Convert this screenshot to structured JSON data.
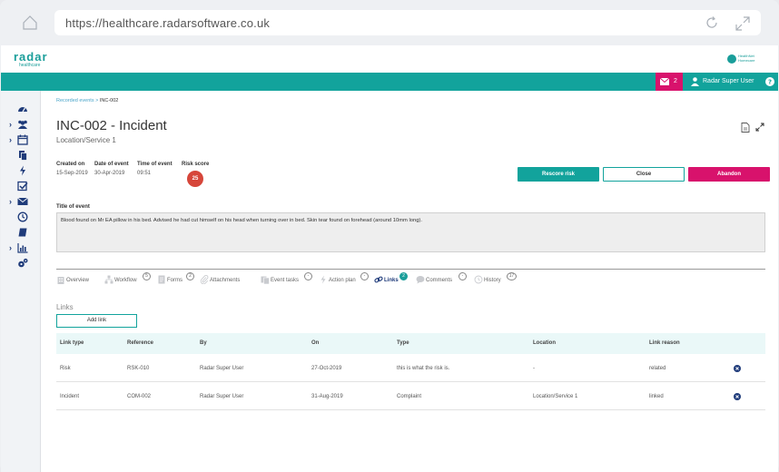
{
  "browser": {
    "url": "https://healthcare.radarsoftware.co.uk"
  },
  "header": {
    "logo_text": "radar",
    "logo_sub": "healthcare",
    "partner_logo": "HealthNet Homecare",
    "mail_count": "2",
    "user_name": "Radar Super User"
  },
  "breadcrumb": {
    "parent": "Recorded events",
    "separator": " > ",
    "current": "INC-002"
  },
  "record": {
    "title": "INC-002 - Incident",
    "location": "Location/Service 1",
    "created_on_label": "Created on",
    "created_on": "15-Sep-2019",
    "date_of_event_label": "Date of event",
    "date_of_event": "30-Apr-2019",
    "time_of_event_label": "Time of event",
    "time_of_event": "09:51",
    "risk_score_label": "Risk score",
    "risk_score": "25",
    "title_of_event_label": "Title of event",
    "description": "Blood found on Mr EA pillow in his bed. Advised he had cut himself on his head when turning over in bed. Skin tear found on forehead (around 10mm long)."
  },
  "actions": {
    "rescore": "Rescore risk",
    "close": "Close",
    "abandon": "Abandon"
  },
  "tabs": [
    {
      "label": "Overview",
      "count": "",
      "icon": "building-icon"
    },
    {
      "label": "Workflow",
      "count": "5",
      "icon": "workflow-icon"
    },
    {
      "label": "Forms",
      "count": "2",
      "icon": "forms-icon"
    },
    {
      "label": "Attachments",
      "count": "",
      "icon": "paperclip-icon"
    },
    {
      "label": "Event tasks",
      "count": "-",
      "icon": "tasks-icon"
    },
    {
      "label": "Action plan",
      "count": "-",
      "icon": "bolt-icon"
    },
    {
      "label": "Links",
      "count": "2",
      "icon": "link-icon"
    },
    {
      "label": "Comments",
      "count": "-",
      "icon": "comment-icon"
    },
    {
      "label": "History",
      "count": "17",
      "icon": "clock-icon"
    }
  ],
  "links": {
    "section_title": "Links",
    "add_button": "Add link",
    "columns": [
      "Link type",
      "Reference",
      "By",
      "On",
      "Type",
      "Location",
      "Link reason"
    ],
    "rows": [
      [
        "Risk",
        "RSK-010",
        "Radar Super User",
        "27-Oct-2019",
        "this is what the risk is.",
        "-",
        "related"
      ],
      [
        "Incident",
        "COM-002",
        "Radar Super User",
        "31-Aug-2019",
        "Complaint",
        "Location/Service 1",
        "linked"
      ]
    ]
  },
  "colors": {
    "teal": "#12a39c",
    "magenta": "#d8126c",
    "navy": "#1f3b7a",
    "risk_red": "#d6463a"
  }
}
